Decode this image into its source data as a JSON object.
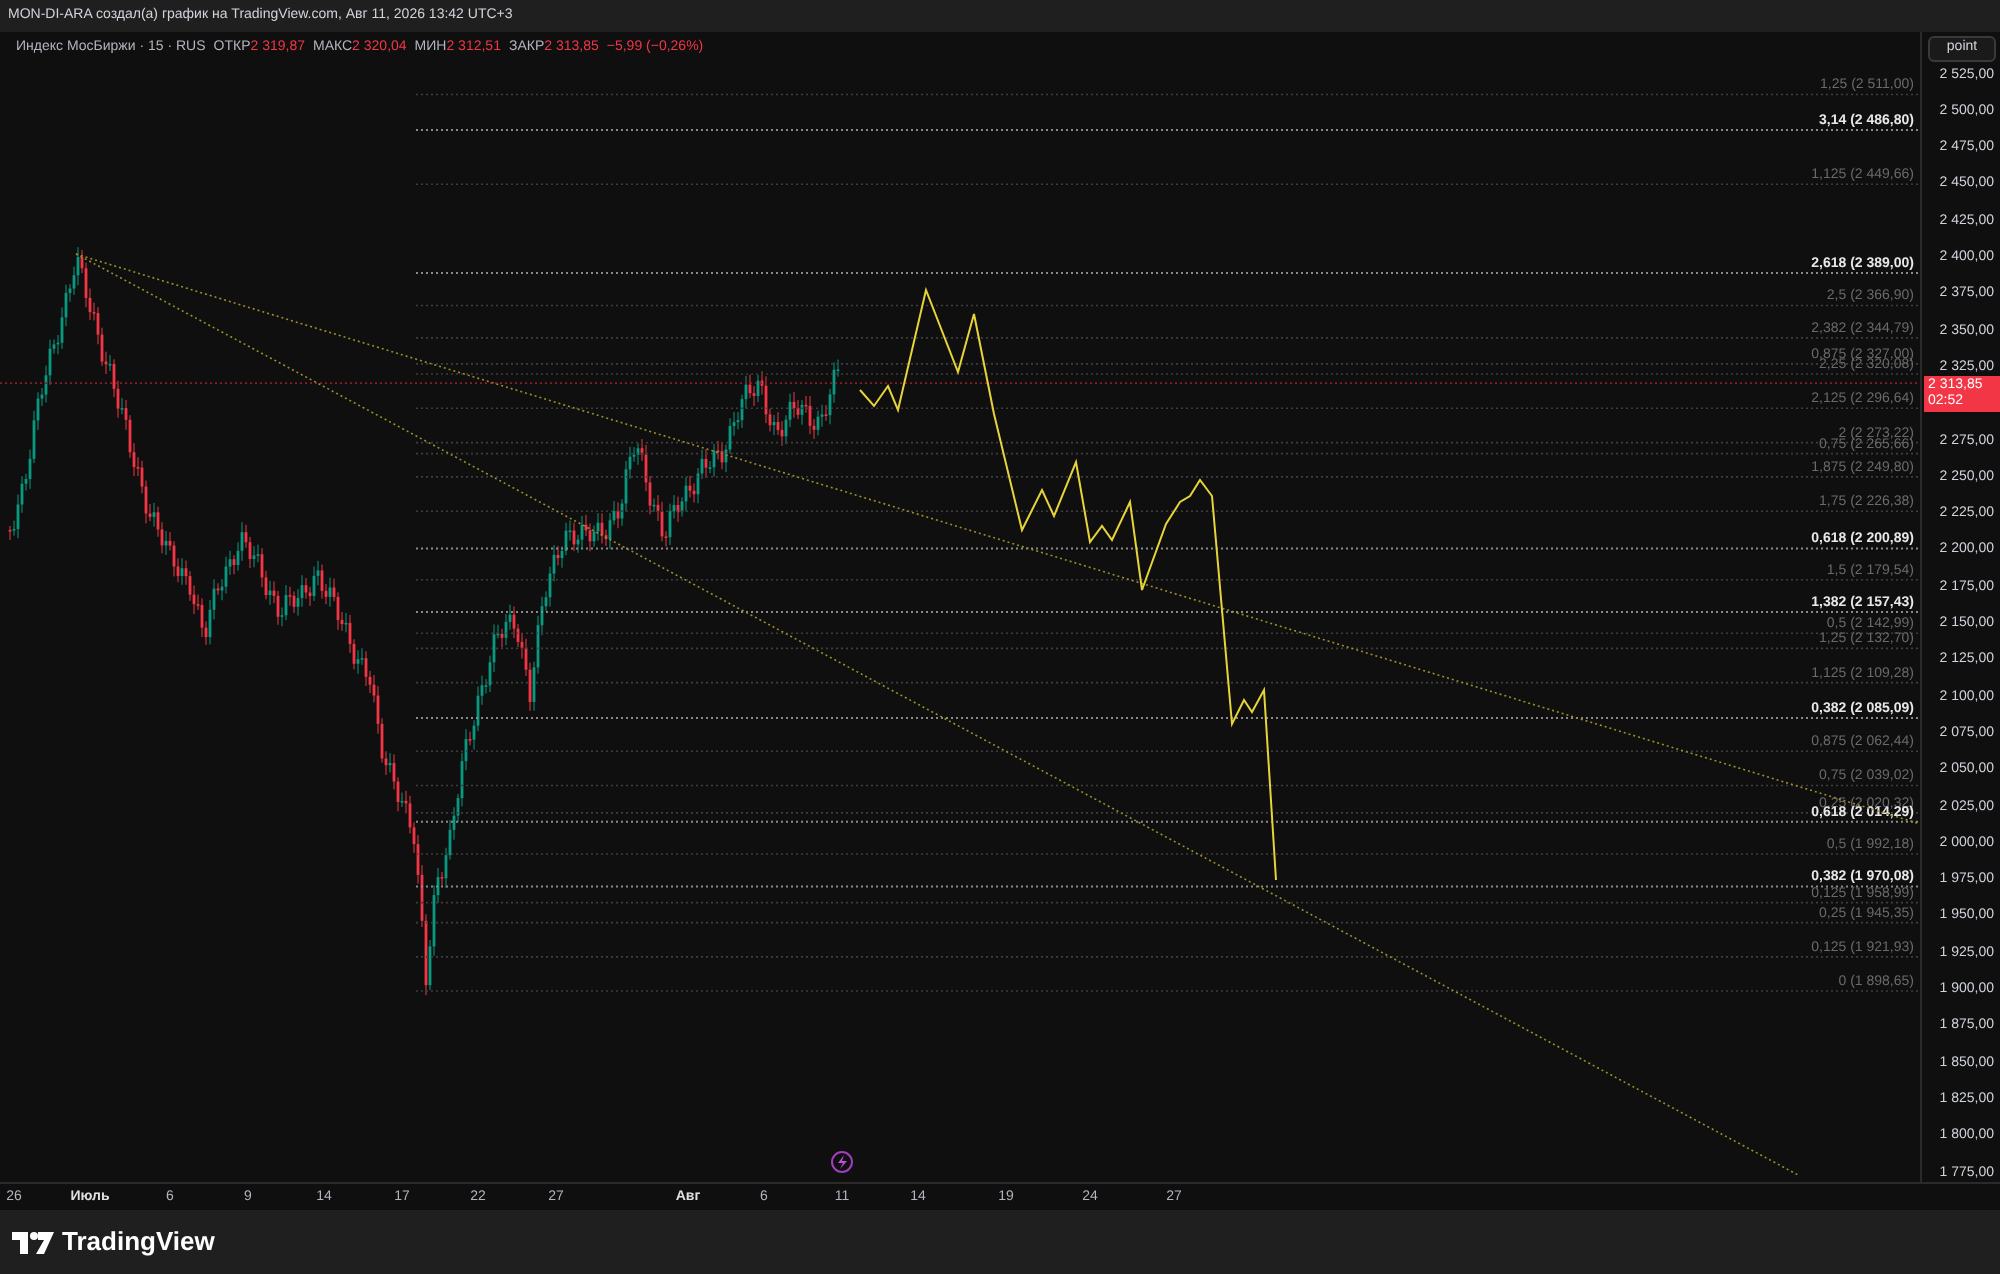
{
  "header": {
    "title": "MON-DI-ARA создал(а) график на TradingView.com, Авг 11, 2026 13:42 UTC+3"
  },
  "legend": {
    "symbol": "Индекс МосБиржи · 15 · RUS",
    "values": [
      {
        "label": "ОТКР",
        "value": "2 319,87"
      },
      {
        "label": "МАКС",
        "value": "2 320,04"
      },
      {
        "label": "МИН",
        "value": "2 312,51"
      },
      {
        "label": "ЗАКР",
        "value": "2 313,85"
      }
    ],
    "change": "−5,99 (−0,26%)"
  },
  "scale_button": "point",
  "price_axis": [
    "2 525,00",
    "2 500,00",
    "2 475,00",
    "2 450,00",
    "2 425,00",
    "2 400,00",
    "2 375,00",
    "2 350,00",
    "2 325,00",
    "2 275,00",
    "2 250,00",
    "2 225,00",
    "2 200,00",
    "2 175,00",
    "2 150,00",
    "2 125,00",
    "2 100,00",
    "2 075,00",
    "2 050,00",
    "2 025,00",
    "2 000,00",
    "1 975,00",
    "1 950,00",
    "1 925,00",
    "1 900,00",
    "1 875,00",
    "1 850,00",
    "1 825,00",
    "1 800,00",
    "1 775,00"
  ],
  "current_price": {
    "price": "2 313,85",
    "countdown": "02:52"
  },
  "fib_levels": [
    {
      "label": "1,25 (2 511,00)",
      "highlighted": false
    },
    {
      "label": "3,14 (2 486,80)",
      "highlighted": true
    },
    {
      "label": "1,125 (2 449,66)",
      "highlighted": false
    },
    {
      "label": "2,618 (2 389,00)",
      "highlighted": true
    },
    {
      "label": "2,5 (2 366,90)",
      "highlighted": false
    },
    {
      "label": "2,382 (2 344,79)",
      "highlighted": false
    },
    {
      "label": "0,875 (2 327,00)",
      "highlighted": false
    },
    {
      "label": "2,25 (2 320,08)",
      "highlighted": false
    },
    {
      "label": "2,125 (2 296,64)",
      "highlighted": false
    },
    {
      "label": "2 (2 273,22)",
      "highlighted": false
    },
    {
      "label": "0,75 (2 265,66)",
      "highlighted": false
    },
    {
      "label": "1,875 (2 249,80)",
      "highlighted": false
    },
    {
      "label": "1,75 (2 226,38)",
      "highlighted": false
    },
    {
      "label": "0,618 (2 200,89)",
      "highlighted": true
    },
    {
      "label": "1,5 (2 179,54)",
      "highlighted": false
    },
    {
      "label": "1,382 (2 157,43)",
      "highlighted": true
    },
    {
      "label": "0,5 (2 142,99)",
      "highlighted": false
    },
    {
      "label": "1,25 (2 132,70)",
      "highlighted": false
    },
    {
      "label": "1,125 (2 109,28)",
      "highlighted": false
    },
    {
      "label": "0,382 (2 085,09)",
      "highlighted": true
    },
    {
      "label": "0,875 (2 062,44)",
      "highlighted": false
    },
    {
      "label": "0,75 (2 039,02)",
      "highlighted": false
    },
    {
      "label": "0,25 (2 020,32)",
      "highlighted": false
    },
    {
      "label": "0,618 (2 014,29)",
      "highlighted": true
    },
    {
      "label": "0,5 (1 992,18)",
      "highlighted": false
    },
    {
      "label": "0,382 (1 970,08)",
      "highlighted": true
    },
    {
      "label": "0,125 (1 958,99)",
      "highlighted": false
    },
    {
      "label": "0,25 (1 945,35)",
      "highlighted": false
    },
    {
      "label": "0,125 (1 921,93)",
      "highlighted": false
    },
    {
      "label": "0 (1 898,65)",
      "highlighted": false
    }
  ],
  "time_axis": [
    {
      "label": "26",
      "kind": "day"
    },
    {
      "label": "Июль",
      "kind": "month"
    },
    {
      "label": "6",
      "kind": "day"
    },
    {
      "label": "9",
      "kind": "day"
    },
    {
      "label": "14",
      "kind": "day"
    },
    {
      "label": "17",
      "kind": "day"
    },
    {
      "label": "22",
      "kind": "day"
    },
    {
      "label": "27",
      "kind": "day"
    },
    {
      "label": "Авг",
      "kind": "month"
    },
    {
      "label": "6",
      "kind": "day"
    },
    {
      "label": "11",
      "kind": "day"
    },
    {
      "label": "14",
      "kind": "day"
    },
    {
      "label": "19",
      "kind": "day"
    },
    {
      "label": "24",
      "kind": "day"
    },
    {
      "label": "27",
      "kind": "day"
    }
  ],
  "footer": {
    "logo_text": "TradingView"
  }
}
